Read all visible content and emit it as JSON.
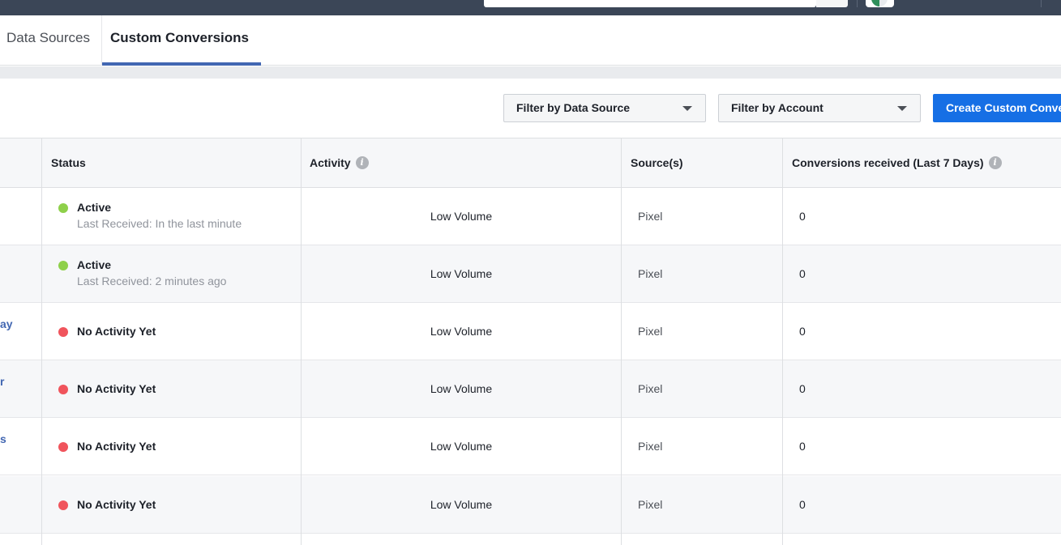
{
  "tabs": [
    {
      "label": "Data Sources"
    },
    {
      "label": "Custom Conversions"
    }
  ],
  "toolbar": {
    "filter_data_source": "Filter by Data Source",
    "filter_account": "Filter by Account",
    "create_label": "Create Custom Conversion"
  },
  "table": {
    "headers": {
      "status": "Status",
      "activity": "Activity",
      "sources": "Source(s)",
      "conversions": "Conversions received (Last 7 Days)"
    },
    "info_glyph": "i",
    "rows": [
      {
        "name_fragment": "",
        "status": "Active",
        "status_color": "#8ed04a",
        "last_received": "Last Received: In the last minute",
        "activity": "Low Volume",
        "source": "Pixel",
        "conversions": "0"
      },
      {
        "name_fragment": "",
        "status": "Active",
        "status_color": "#8ed04a",
        "last_received": "Last Received: 2 minutes ago",
        "activity": "Low Volume",
        "source": "Pixel",
        "conversions": "0"
      },
      {
        "name_fragment": "ay",
        "status": "No Activity Yet",
        "status_color": "#f0545c",
        "last_received": "",
        "activity": "Low Volume",
        "source": "Pixel",
        "conversions": "0"
      },
      {
        "name_fragment": "r",
        "status": "No Activity Yet",
        "status_color": "#f0545c",
        "last_received": "",
        "activity": "Low Volume",
        "source": "Pixel",
        "conversions": "0"
      },
      {
        "name_fragment": "s",
        "status": "No Activity Yet",
        "status_color": "#f0545c",
        "last_received": "",
        "activity": "Low Volume",
        "source": "Pixel",
        "conversions": "0"
      },
      {
        "name_fragment": "",
        "status": "No Activity Yet",
        "status_color": "#f0545c",
        "last_received": "",
        "activity": "Low Volume",
        "source": "Pixel",
        "conversions": "0"
      }
    ]
  },
  "colors": {
    "topbar": "#3b4657",
    "accent": "#4267b2",
    "primary_button": "#166fe5",
    "active_dot": "#8ed04a",
    "inactive_dot": "#f0545c"
  }
}
